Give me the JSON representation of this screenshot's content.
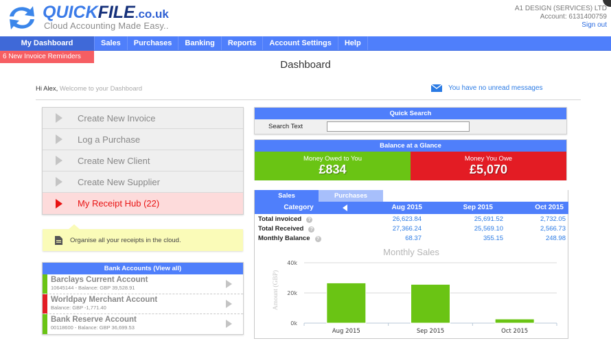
{
  "header": {
    "brand_quick": "QUICK",
    "brand_file": "FILE",
    "brand_domain": ".co.uk",
    "tagline": "Cloud Accounting Made Easy..",
    "company": "A1 DESIGN (SERVICES) LTD",
    "account": "Account: 6131400759",
    "sign_out": "Sign out"
  },
  "nav": {
    "items": [
      {
        "label": "My Dashboard",
        "active": true
      },
      {
        "label": "Sales"
      },
      {
        "label": "Purchases"
      },
      {
        "label": "Banking"
      },
      {
        "label": "Reports"
      },
      {
        "label": "Account Settings"
      },
      {
        "label": "Help"
      }
    ],
    "reminder": "6 New Invoice Reminders"
  },
  "page": {
    "title": "Dashboard",
    "greeting_name": "Hi Alex,",
    "greeting_text": " Welcome to your Dashboard",
    "messages": "You have no unread messages"
  },
  "actions": [
    {
      "label": "Create New Invoice",
      "icon": "play-arrow-icon"
    },
    {
      "label": "Log a Purchase",
      "icon": "play-arrow-icon"
    },
    {
      "label": "Create New Client",
      "icon": "play-arrow-icon"
    },
    {
      "label": "Create New Supplier",
      "icon": "play-arrow-icon"
    },
    {
      "label": "My Receipt Hub (22)",
      "icon": "play-arrow-icon",
      "highlight": true
    }
  ],
  "tip": {
    "text": "Organise all your receipts in the cloud.",
    "icon": "document-icon"
  },
  "bank_accounts": {
    "header": "Bank Accounts (View all)",
    "items": [
      {
        "name": "Barclays Current Account",
        "detail": "10645144 - Balance: GBP 39,528.91",
        "status_color": "#6ac414"
      },
      {
        "name": "Worldpay Merchant Account",
        "detail": "Balance: GBP -1,771.40",
        "status_color": "#e31c24"
      },
      {
        "name": "Bank Reserve Account",
        "detail": "00118600 - Balance: GBP 36,699.53",
        "status_color": "#6ac414"
      }
    ]
  },
  "quick_search": {
    "header": "Quick Search",
    "label": "Search Text",
    "value": "",
    "placeholder": ""
  },
  "balance": {
    "header": "Balance at a Glance",
    "owed_to_you_label": "Money Owed to You",
    "owed_to_you_value": "£834",
    "you_owe_label": "Money You Owe",
    "you_owe_value": "£5,070"
  },
  "sales_panel": {
    "tabs": [
      {
        "label": "Sales",
        "active": true
      },
      {
        "label": "Purchases",
        "active": false
      }
    ],
    "columns": [
      "Category",
      "Aug 2015",
      "Sep 2015",
      "Oct 2015"
    ],
    "rows": [
      {
        "label": "Total invoiced",
        "values": [
          "26,623.84",
          "25,691.52",
          "2,732.05"
        ]
      },
      {
        "label": "Total Received",
        "values": [
          "27,366.24",
          "25,569.10",
          "2,566.73"
        ]
      },
      {
        "label": "Monthly Balance",
        "values": [
          "68.37",
          "355.15",
          "248.98"
        ]
      }
    ]
  },
  "chart_data": {
    "type": "bar",
    "title": "Monthly Sales",
    "xlabel": "",
    "ylabel": "Amount (GBP)",
    "categories": [
      "Aug 2015",
      "Sep 2015",
      "Oct 2015"
    ],
    "values": [
      26623.84,
      25691.52,
      2732.05
    ],
    "yticks": [
      "0k",
      "20k",
      "40k"
    ],
    "ylim": [
      0,
      40000
    ],
    "grid": true,
    "bar_color": "#6ac414"
  }
}
